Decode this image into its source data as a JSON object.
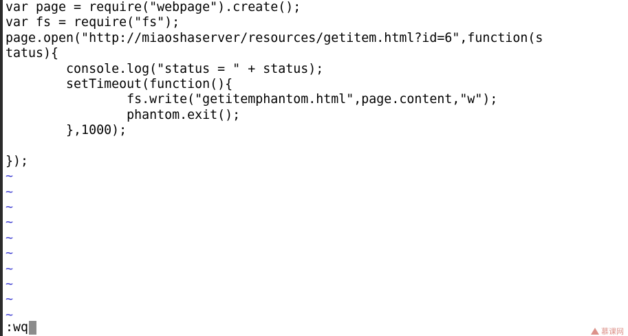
{
  "editor": {
    "lines": [
      "var page = require(\"webpage\").create();",
      "var fs = require(\"fs\");",
      "page.open(\"http://miaoshaserver/resources/getitem.html?id=6\",function(s",
      "tatus){",
      "        console.log(\"status = \" + status);",
      "        setTimeout(function(){",
      "                fs.write(\"getitemphantom.html\",page.content,\"w\");",
      "                phantom.exit();",
      "        },1000);",
      "",
      "});"
    ],
    "empty_line_marker": "~",
    "empty_line_count": 10,
    "command": ":wq"
  },
  "colors": {
    "background": "#ffffff",
    "text": "#000000",
    "tilde": "#3b3bd0",
    "cursor": "#8c8c8c"
  },
  "watermark": {
    "icon": "triangle-logo-icon",
    "text": "慕课网"
  }
}
